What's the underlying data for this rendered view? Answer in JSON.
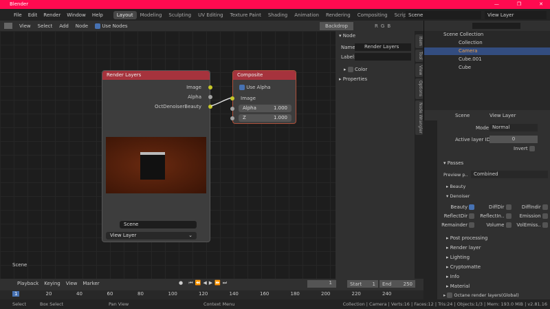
{
  "window": {
    "title": "Blender",
    "controls": [
      "—",
      "❐",
      "✕"
    ]
  },
  "menu": [
    "File",
    "Edit",
    "Render",
    "Window",
    "Help"
  ],
  "workspaces": [
    "Layout",
    "Modeling",
    "Sculpting",
    "UV Editing",
    "Texture Paint",
    "Shading",
    "Animation",
    "Rendering",
    "Compositing",
    "Scripting"
  ],
  "active_workspace": "Layout",
  "scene": "Scene",
  "view_layer": "View Layer",
  "node_header": {
    "menus": [
      "View",
      "Select",
      "Add",
      "Node"
    ],
    "use_nodes": "Use Nodes",
    "backdrop": "Backdrop",
    "channels": [
      "R",
      "G",
      "B"
    ]
  },
  "render_layers_node": {
    "title": "Render Layers",
    "outputs": [
      "Image",
      "Alpha",
      "OctDenoiserBeauty"
    ],
    "scene": "Scene",
    "layer": "View Layer"
  },
  "composite_node": {
    "title": "Composite",
    "use_alpha": "Use Alpha",
    "inputs": {
      "image": "Image",
      "alpha": "Alpha",
      "alpha_val": "1.000",
      "z": "Z",
      "z_val": "1.000"
    }
  },
  "editor_label": "Scene",
  "npanel": {
    "section": "Node",
    "name_label": "Name:",
    "name_value": "Render Layers",
    "label_label": "Label:",
    "color": "Color",
    "properties": "Properties"
  },
  "sidetabs": [
    "Item",
    "Tool",
    "View",
    "Options",
    "Node Wrangler"
  ],
  "outliner": {
    "root": "Scene Collection",
    "items": [
      "Collection",
      "Camera",
      "Cube.001",
      "Cube"
    ]
  },
  "properties": {
    "scene": "Scene",
    "view_layer": "View Layer",
    "mode_label": "Mode",
    "mode": "Normal",
    "layer_id_label": "Active layer ID",
    "layer_id": "0",
    "invert": "Invert",
    "passes": "Passes",
    "preview_label": "Preview p..",
    "preview": "Combined",
    "beauty": "Beauty",
    "denoiser": "Denoiser",
    "checks": [
      [
        "Beauty",
        true
      ],
      [
        "DiffDir",
        false
      ],
      [
        "DiffIndir",
        false
      ],
      [
        "ReflectDir",
        false
      ],
      [
        "ReflectIn..",
        false
      ],
      [
        "Emission",
        false
      ],
      [
        "Remainder",
        false
      ],
      [
        "Volume",
        false
      ],
      [
        "VolEmiss..",
        false
      ]
    ],
    "subpanels": [
      "Post processing",
      "Render layer",
      "Lighting",
      "Cryptomatte",
      "Info",
      "Material"
    ],
    "octane": "Octane render layers(Global)"
  },
  "timeline": {
    "menus": [
      "Playback",
      "Keying",
      "View",
      "Marker"
    ],
    "current": "1",
    "start_label": "Start",
    "start": "1",
    "end_label": "End",
    "end": "250",
    "ticks": [
      "1",
      "20",
      "40",
      "60",
      "80",
      "100",
      "120",
      "140",
      "160",
      "180",
      "200",
      "220",
      "240"
    ]
  },
  "status": {
    "select": "Select",
    "box_select": "Box Select",
    "pan": "Pan View",
    "context": "Context Menu",
    "info": "Collection | Camera | Verts:16 | Faces:12 | Tris:24 | Objects:1/3 | Mem: 193.0 MiB | v2.81.16"
  }
}
